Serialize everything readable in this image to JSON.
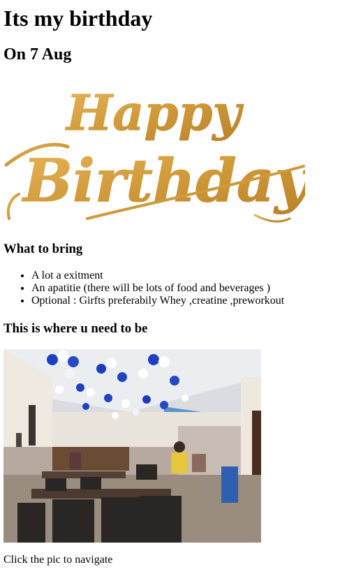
{
  "page": {
    "title": "Its my birthday",
    "date": "On 7 Aug"
  },
  "logo": {
    "alt": "Happy Birthday",
    "color": "#d8a340"
  },
  "bring": {
    "heading": "What to bring",
    "items": [
      "A lot a exitment",
      "An apatitie (there will be lots of food and beverages )",
      "Optional : Girfts preferabily Whey ,creatine ,preworkout"
    ]
  },
  "venue": {
    "heading": "This is where u need to be",
    "photo_alt": "Restaurant with blue and white balloons",
    "caption": "Click the pic to navigate"
  }
}
